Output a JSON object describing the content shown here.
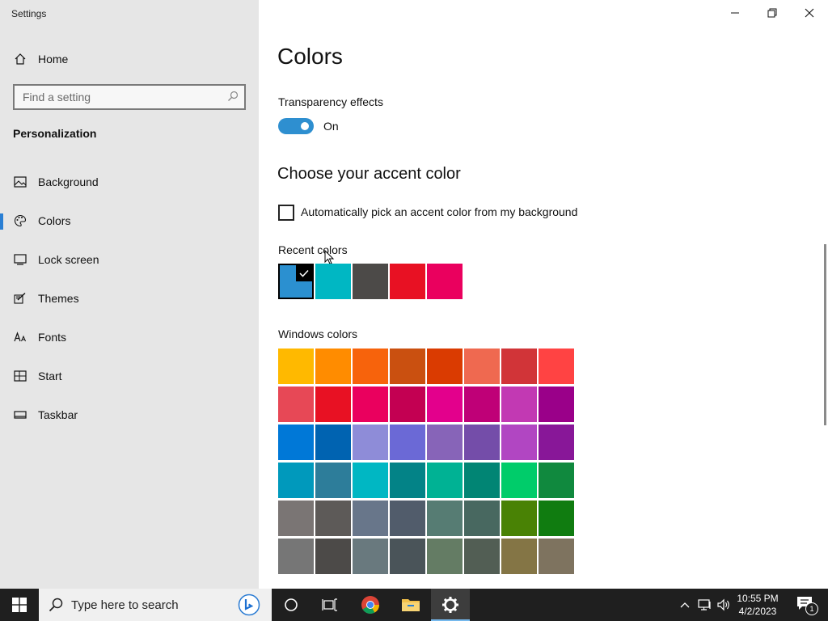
{
  "window": {
    "title": "Settings"
  },
  "sidebar": {
    "home_label": "Home",
    "search_placeholder": "Find a setting",
    "section": "Personalization",
    "items": [
      {
        "label": "Background",
        "icon": "picture-icon",
        "selected": false
      },
      {
        "label": "Colors",
        "icon": "palette-icon",
        "selected": true
      },
      {
        "label": "Lock screen",
        "icon": "lock-screen-icon",
        "selected": false
      },
      {
        "label": "Themes",
        "icon": "brush-icon",
        "selected": false
      },
      {
        "label": "Fonts",
        "icon": "font-icon",
        "selected": false
      },
      {
        "label": "Start",
        "icon": "start-icon",
        "selected": false
      },
      {
        "label": "Taskbar",
        "icon": "taskbar-icon",
        "selected": false
      }
    ]
  },
  "main": {
    "title": "Colors",
    "transparency": {
      "label": "Transparency effects",
      "state_label": "On",
      "enabled": true
    },
    "accent_heading": "Choose your accent color",
    "auto_pick": {
      "label": "Automatically pick an accent color from my background",
      "checked": false
    },
    "recent_colors": {
      "label": "Recent colors",
      "colors": [
        "#2b90d0",
        "#00b7c3",
        "#4c4a48",
        "#e81123",
        "#ea005e"
      ],
      "selected_index": 0
    },
    "windows_colors": {
      "label": "Windows colors",
      "rows": [
        [
          "#ffb900",
          "#ff8c00",
          "#f7630c",
          "#ca5010",
          "#da3b01",
          "#ef6950",
          "#d13438",
          "#ff4343"
        ],
        [
          "#e74856",
          "#e81123",
          "#ea005e",
          "#c30052",
          "#e3008c",
          "#bf0077",
          "#c239b3",
          "#9a0089"
        ],
        [
          "#0078d7",
          "#0063b1",
          "#8e8cd8",
          "#6b69d6",
          "#8764b8",
          "#744da9",
          "#b146c2",
          "#881798"
        ],
        [
          "#0099bc",
          "#2d7d9a",
          "#00b7c3",
          "#038387",
          "#00b294",
          "#018574",
          "#00cc6a",
          "#10893e"
        ],
        [
          "#7a7574",
          "#5d5a58",
          "#68768a",
          "#515c6b",
          "#567c73",
          "#486860",
          "#498205",
          "#107c10"
        ],
        [
          "#767676",
          "#4c4a48",
          "#69797e",
          "#4a5459",
          "#647c64",
          "#525e54",
          "#847545",
          "#7e735f"
        ]
      ]
    }
  },
  "taskbar": {
    "search_placeholder": "Type here to search",
    "time": "10:55 PM",
    "date": "4/2/2023",
    "notification_count": "1"
  }
}
